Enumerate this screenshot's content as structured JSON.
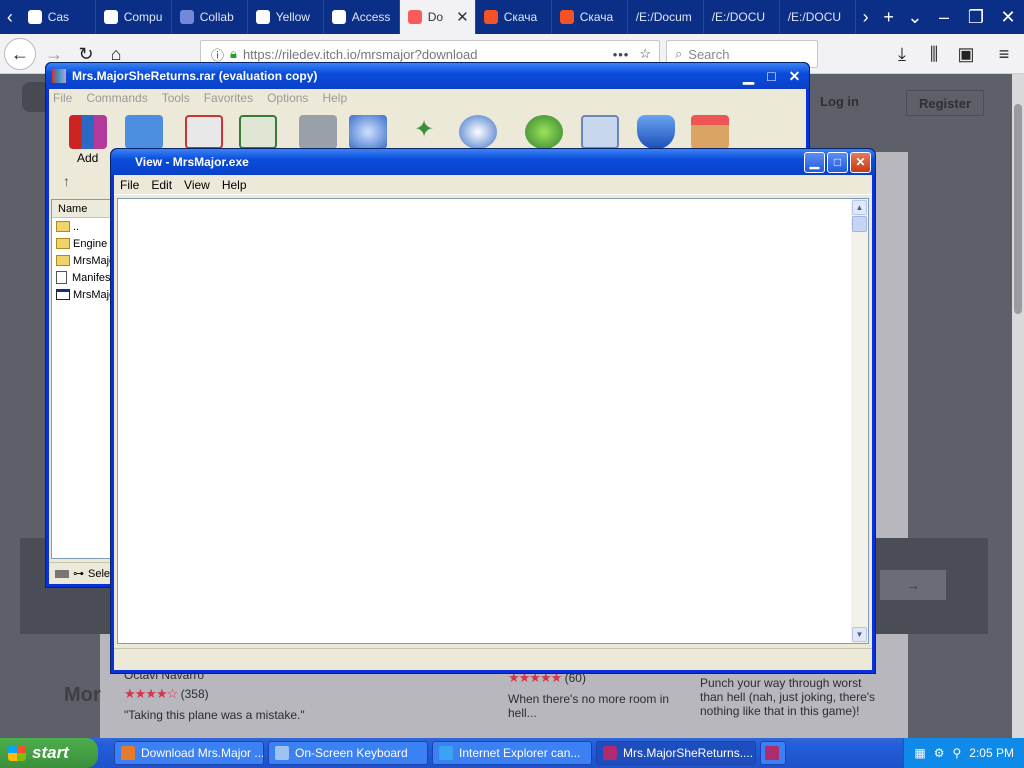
{
  "browser": {
    "tabs": [
      {
        "label": "Cas",
        "color": "#ffffff"
      },
      {
        "label": "Compu",
        "color": "#ffffff"
      },
      {
        "label": "Collab",
        "color": "#7289da"
      },
      {
        "label": "Yellow",
        "color": "#ffffff"
      },
      {
        "label": "Access",
        "color": "#ffffff"
      },
      {
        "label": "Do",
        "color": "#fa5c5c"
      },
      {
        "label": "Скача",
        "color": "#f35325"
      },
      {
        "label": "Скача",
        "color": "#f35325"
      },
      {
        "label": "/E:/Docum",
        "color": ""
      },
      {
        "label": "/E:/DOCU",
        "color": ""
      },
      {
        "label": "/E:/DOCU",
        "color": ""
      }
    ],
    "url": "https://riledev.itch.io/mrsmajor?download",
    "search_placeholder": "Search",
    "page_menu_dots": "•••"
  },
  "page": {
    "login": "Log in",
    "register": "Register",
    "more_heading": "Mor",
    "games": [
      {
        "author": "Octavi Navarro",
        "stars": "★★★★☆",
        "count": "(358)",
        "blurb": "\"Taking this plane was a mistake.\""
      },
      {
        "author": "",
        "stars": "★★★★★",
        "count": "(60)",
        "blurb": "When there's no more room in hell..."
      },
      {
        "author": "",
        "stars": "",
        "count": "",
        "blurb": "Punch your way through worst than hell (nah, just joking, there's nothing like that in this game)!"
      }
    ]
  },
  "rar": {
    "title": "Mrs.MajorSheReturns.rar (evaluation copy)",
    "menu": [
      "File",
      "Commands",
      "Tools",
      "Favorites",
      "Options",
      "Help"
    ],
    "add_label": "Add",
    "column_name": "Name",
    "files": [
      {
        "type": "folder",
        "name": ".."
      },
      {
        "type": "folder",
        "name": "Engine"
      },
      {
        "type": "folder",
        "name": "MrsMajor"
      },
      {
        "type": "doc",
        "name": "Manifest"
      },
      {
        "type": "exe",
        "name": "MrsMajor"
      }
    ],
    "status": "Sele"
  },
  "view": {
    "title": "View - MrsMajor.exe",
    "menu": [
      "File",
      "Edit",
      "View",
      "Help"
    ]
  },
  "taskbar": {
    "start": "start",
    "tasks": [
      {
        "label": "Download Mrs.Major ...",
        "color": "#e87a2c"
      },
      {
        "label": "On-Screen Keyboard",
        "color": "#9fc3f0"
      },
      {
        "label": "Internet Explorer can...",
        "color": "#3ba4f0"
      },
      {
        "label": "Mrs.MajorSheReturns....",
        "color": "#b02a6e"
      }
    ],
    "time": "2:05 PM"
  }
}
